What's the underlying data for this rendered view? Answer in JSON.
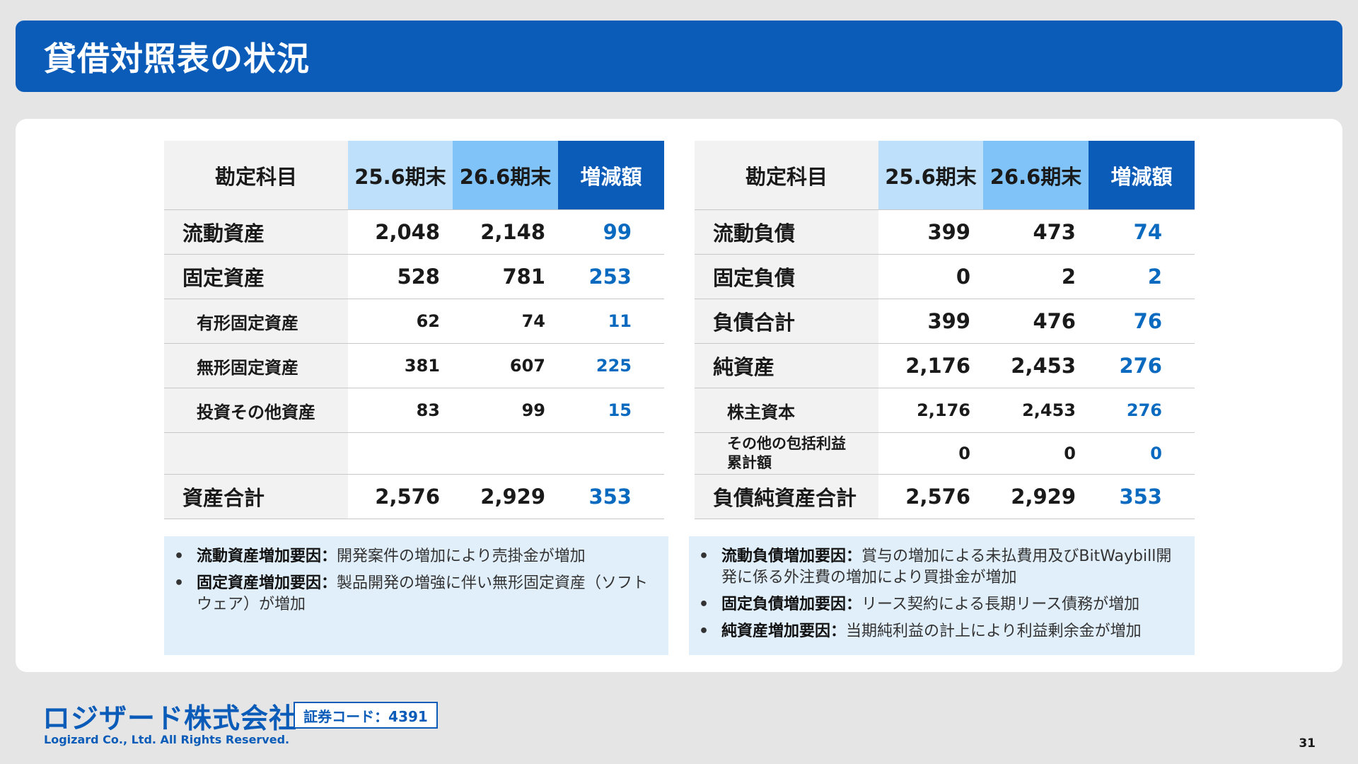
{
  "header": {
    "title": "貸借対照表の状況"
  },
  "columns": {
    "label": "勘定科目",
    "period_prev": "25.6期末",
    "period_curr": "26.6期末",
    "change": "増減額"
  },
  "assets": {
    "rows": [
      {
        "label": "流動資産",
        "prev": "2,048",
        "curr": "2,148",
        "change": "99"
      },
      {
        "label": "固定資産",
        "prev": "528",
        "curr": "781",
        "change": "253"
      },
      {
        "label": "有形固定資産",
        "prev": "62",
        "curr": "74",
        "change": "11"
      },
      {
        "label": "無形固定資産",
        "prev": "381",
        "curr": "607",
        "change": "225"
      },
      {
        "label": "投資その他資産",
        "prev": "83",
        "curr": "99",
        "change": "15"
      },
      {
        "label": "",
        "prev": "",
        "curr": "",
        "change": ""
      },
      {
        "label": "資産合計",
        "prev": "2,576",
        "curr": "2,929",
        "change": "353"
      }
    ]
  },
  "liabilities": {
    "rows": [
      {
        "label": "流動負債",
        "prev": "399",
        "curr": "473",
        "change": "74"
      },
      {
        "label": "固定負債",
        "prev": "0",
        "curr": "2",
        "change": "2"
      },
      {
        "label": "負債合計",
        "prev": "399",
        "curr": "476",
        "change": "76"
      },
      {
        "label": "純資産",
        "prev": "2,176",
        "curr": "2,453",
        "change": "276"
      },
      {
        "label": "株主資本",
        "prev": "2,176",
        "curr": "2,453",
        "change": "276"
      },
      {
        "label_line1": "その他の包括利益",
        "label_line2": "累計額",
        "prev": "0",
        "curr": "0",
        "change": "0"
      },
      {
        "label": "負債純資産合計",
        "prev": "2,576",
        "curr": "2,929",
        "change": "353"
      }
    ]
  },
  "notes_left": [
    {
      "bullet": "•",
      "key": "流動資産増加要因：",
      "text": "開発案件の増加により売掛金が増加"
    },
    {
      "bullet": "•",
      "key": "固定資産増加要因：",
      "text": "製品開発の増強に伴い無形固定資産（ソフトウェア）が増加"
    }
  ],
  "notes_right": [
    {
      "bullet": "•",
      "key": "流動負債増加要因：",
      "text": "賞与の増加による未払費用及びBitWaybill開発に係る外注費の増加により買掛金が増加"
    },
    {
      "bullet": "•",
      "key": "固定負債増加要因：",
      "text": "リース契約による長期リース債務が増加"
    },
    {
      "bullet": "•",
      "key": "純資産増加要因：",
      "text": "当期純利益の計上により利益剰余金が増加"
    }
  ],
  "footer": {
    "company": "ロジザード株式会社",
    "stock_code": "証券コード：4391",
    "copyright": "Logizard Co., Ltd. All Rights Reserved.",
    "page": "31"
  },
  "colors": {
    "brand": "#0a5cb8",
    "accent_number": "#0a6abf",
    "col_prev": "#bfe0fb",
    "col_curr": "#7fc3f8",
    "label_bg": "#f2f2f2",
    "note_bg": "#e1effb"
  }
}
